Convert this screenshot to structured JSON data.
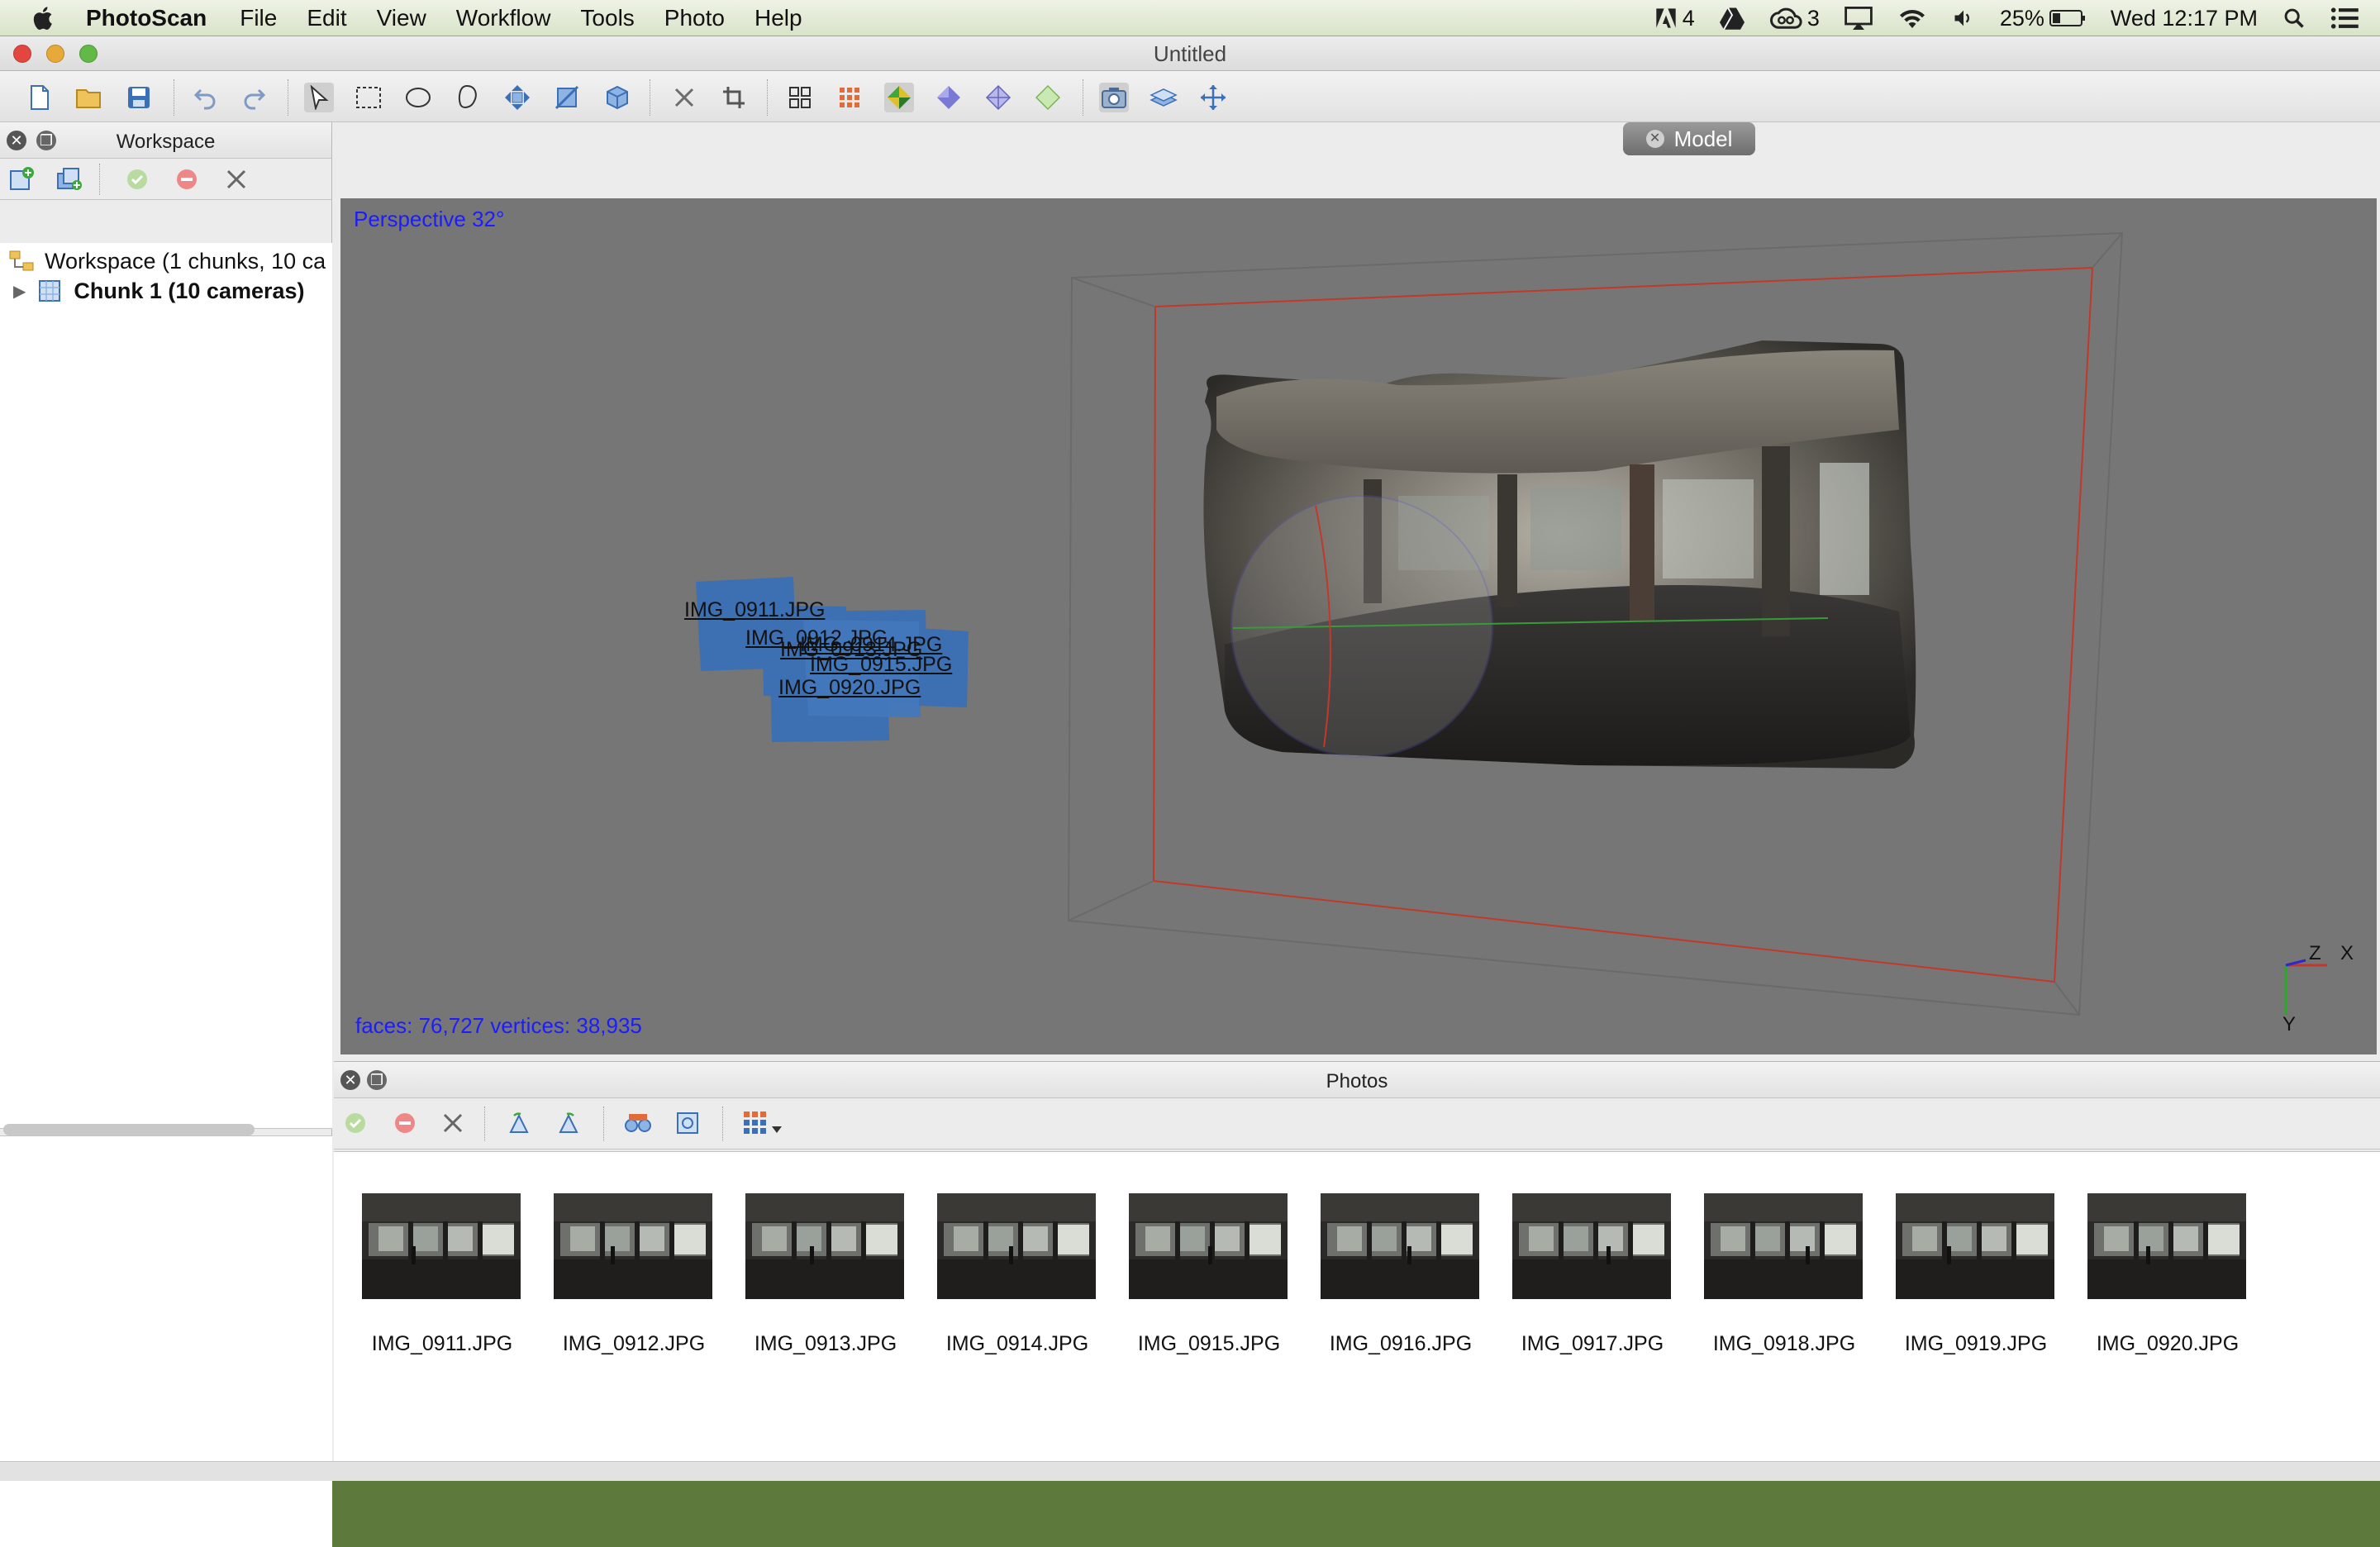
{
  "menubar": {
    "app_name": "PhotoScan",
    "menus": [
      "File",
      "Edit",
      "View",
      "Workflow",
      "Tools",
      "Photo",
      "Help"
    ],
    "status": {
      "adobe_count": "4",
      "cc_count": "3",
      "battery": "25%",
      "clock": "Wed 12:17 PM"
    }
  },
  "window": {
    "title": "Untitled"
  },
  "workspace": {
    "panel_title": "Workspace",
    "root_label": "Workspace (1 chunks, 10 ca",
    "chunk_label": "Chunk 1 (10 cameras)"
  },
  "model": {
    "tab_label": "Model",
    "projection": "Perspective 32°",
    "stats": "faces: 76,727 vertices: 38,935",
    "camera_labels": [
      "IMG_0911.JPG",
      "IMG_0912.JPG",
      "IMG_0920.JPG",
      "IMG_0913.JPG",
      "IMG_0914.JPG",
      "IMG_0915.JPG"
    ],
    "axis": {
      "x": "X",
      "y": "Y",
      "z": "Z"
    }
  },
  "photos": {
    "panel_title": "Photos",
    "items": [
      "IMG_0911.JPG",
      "IMG_0912.JPG",
      "IMG_0913.JPG",
      "IMG_0914.JPG",
      "IMG_0915.JPG",
      "IMG_0916.JPG",
      "IMG_0917.JPG",
      "IMG_0918.JPG",
      "IMG_0919.JPG",
      "IMG_0920.JPG"
    ]
  },
  "colors": {
    "viewport_bg": "#767676",
    "overlay_text": "#1c1cff",
    "camera_fill": "#3d6fb3",
    "bbox_red": "#c0392b"
  }
}
